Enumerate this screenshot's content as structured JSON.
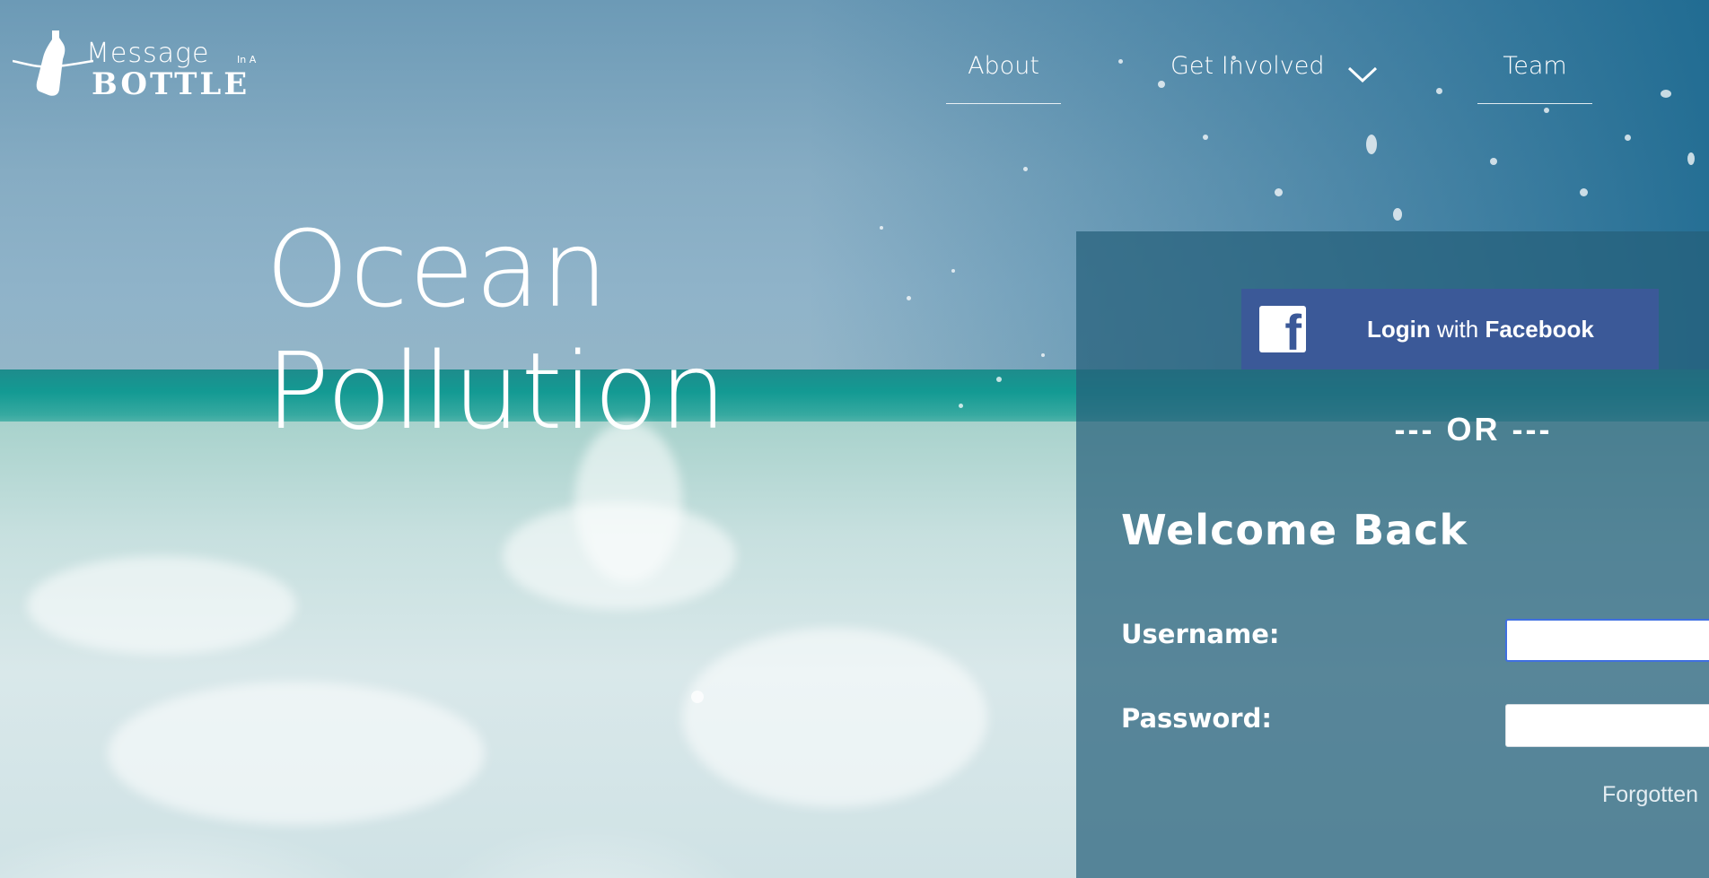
{
  "logo": {
    "line1": "Message",
    "in_a": "In A",
    "line2": "BOTTLE"
  },
  "nav": {
    "about": "About",
    "get_involved": "Get Involved",
    "team": "Team"
  },
  "hero": {
    "line1": "Ocean",
    "line2": "Pollution"
  },
  "login": {
    "facebook_bold_1": "Login",
    "facebook_middle": "with",
    "facebook_bold_2": "Facebook",
    "or_divider": "--- OR ---",
    "welcome": "Welcome Back",
    "username_label": "Username:",
    "password_label": "Password:",
    "username_value": "",
    "password_value": "",
    "forgotten": "Forgotten"
  },
  "colors": {
    "facebook": "#3b5998",
    "panel": "#26607a",
    "input_focus": "#3f6fe0"
  },
  "icons": {
    "logo": "bottle-icon",
    "dropdown": "chevron-down-icon",
    "facebook": "facebook-icon"
  }
}
